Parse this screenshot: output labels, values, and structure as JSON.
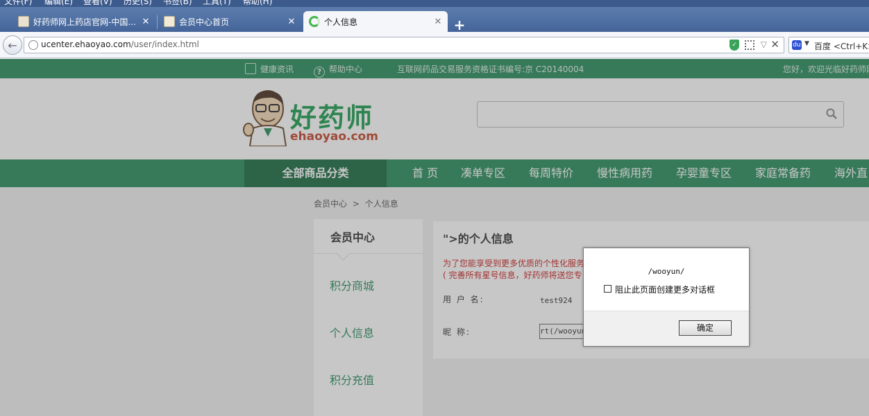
{
  "browser": {
    "menu": [
      "文件(F)",
      "编辑(E)",
      "查看(V)",
      "历史(S)",
      "书签(B)",
      "工具(T)",
      "帮助(H)"
    ],
    "tabs": [
      {
        "title": "好药师网上药店官网-中国...",
        "close": "✕"
      },
      {
        "title": "会员中心首页",
        "close": "✕"
      },
      {
        "title": "个人信息",
        "close": "✕"
      }
    ],
    "new_tab": "+",
    "url_host": "ucenter.ehaoyao.com",
    "url_path": "/user/index.html",
    "search_engine": "百度 <Ctrl+K>",
    "icons": {
      "back": "arrow-left",
      "globe": "globe",
      "shield": "shield",
      "qr": "qr-code",
      "stop": "close"
    }
  },
  "topbar": {
    "health_news": "健康资讯",
    "help_center": "帮助中心",
    "license": "互联网药品交易服务资格证书编号:京 C20140004",
    "welcome": "您好，欢迎光临好药师网"
  },
  "header": {
    "brand_cn": "好药师",
    "brand_en": "ehaoyao.com",
    "search_placeholder": ""
  },
  "nav": {
    "all_categories": "全部商品分类",
    "links": [
      "首 页",
      "凑单专区",
      "每周特价",
      "慢性病用药",
      "孕婴童专区",
      "家庭常备药",
      "海外直"
    ]
  },
  "breadcrumb": {
    "home": "会员中心",
    "sep": ">",
    "current": "个人信息"
  },
  "sidebar": {
    "title": "会员中心",
    "items": [
      "积分商城",
      "个人信息",
      "积分充值"
    ]
  },
  "panel": {
    "title": "\">的个人信息",
    "notice_line1": "为了您能享受到更多优质的个性化服务",
    "notice_line2": "( 完善所有星号信息，好药师将送您专",
    "username_label": "用 户 名:",
    "username_value": "test924",
    "nickname_label": "昵  称:",
    "nickname_value": "rt(/wooyun"
  },
  "dialog": {
    "message": "/wooyun/",
    "checkbox_label": "阻止此页面创建更多对话框",
    "ok_label": "确定"
  },
  "colors": {
    "brand_green": "#2c8e5d",
    "brand_green_dark": "#1d6d44",
    "logo_green": "#1f9e52",
    "logo_red": "#c5492e",
    "notice_red": "#cc2222"
  }
}
